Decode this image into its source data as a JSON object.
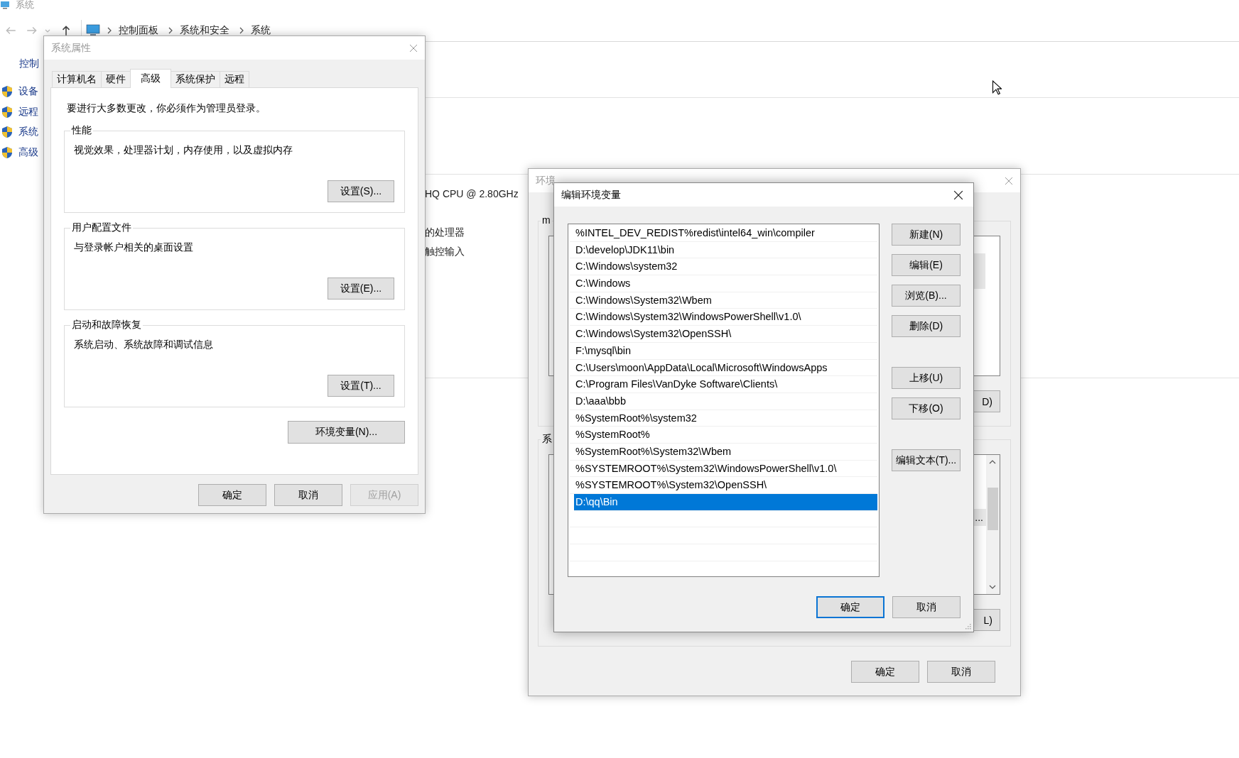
{
  "explorer": {
    "title": "系统",
    "breadcrumb": [
      "控制面板",
      "系统和安全",
      "系统"
    ],
    "sidebar_heading": "控制",
    "sidebar_items": [
      "设备",
      "远程",
      "系统",
      "高级"
    ],
    "info_lines": [
      "HQ CPU @ 2.80GHz",
      "的处理器",
      "触控输入"
    ]
  },
  "system_properties": {
    "title": "系统属性",
    "tabs": [
      {
        "label": "计算机名",
        "selected": false
      },
      {
        "label": "硬件",
        "selected": false
      },
      {
        "label": "高级",
        "selected": true
      },
      {
        "label": "系统保护",
        "selected": false
      },
      {
        "label": "远程",
        "selected": false
      }
    ],
    "notice": "要进行大多数更改，你必须作为管理员登录。",
    "groups": [
      {
        "title": "性能",
        "description": "视觉效果，处理器计划，内存使用，以及虚拟内存",
        "button": "设置(S)..."
      },
      {
        "title": "用户配置文件",
        "description": "与登录帐户相关的桌面设置",
        "button": "设置(E)..."
      },
      {
        "title": "启动和故障恢复",
        "description": "系统启动、系统故障和调试信息",
        "button": "设置(T)..."
      }
    ],
    "env_button": "环境变量(N)...",
    "buttons": [
      {
        "label": "确定",
        "disabled": false
      },
      {
        "label": "取消",
        "disabled": false
      },
      {
        "label": "应用(A)",
        "disabled": true
      }
    ]
  },
  "environment_variables": {
    "title": "环境",
    "user_group_label": "m",
    "system_group_label": "系",
    "system_list_text": "...",
    "user_button": "D)",
    "system_button": "L)",
    "buttons": [
      "确定",
      "取消"
    ]
  },
  "edit_environment_variable": {
    "title": "编辑环境变量",
    "entries": [
      {
        "path": "%INTEL_DEV_REDIST%redist\\intel64_win\\compiler",
        "selected": false
      },
      {
        "path": "D:\\develop\\JDK11\\bin",
        "selected": false
      },
      {
        "path": "C:\\Windows\\system32",
        "selected": false
      },
      {
        "path": "C:\\Windows",
        "selected": false
      },
      {
        "path": "C:\\Windows\\System32\\Wbem",
        "selected": false
      },
      {
        "path": "C:\\Windows\\System32\\WindowsPowerShell\\v1.0\\",
        "selected": false
      },
      {
        "path": "C:\\Windows\\System32\\OpenSSH\\",
        "selected": false
      },
      {
        "path": "F:\\mysql\\bin",
        "selected": false
      },
      {
        "path": "C:\\Users\\moon\\AppData\\Local\\Microsoft\\WindowsApps",
        "selected": false
      },
      {
        "path": "C:\\Program Files\\VanDyke Software\\Clients\\",
        "selected": false
      },
      {
        "path": "D:\\aaa\\bbb",
        "selected": false
      },
      {
        "path": "%SystemRoot%\\system32",
        "selected": false
      },
      {
        "path": "%SystemRoot%",
        "selected": false
      },
      {
        "path": "%SystemRoot%\\System32\\Wbem",
        "selected": false
      },
      {
        "path": "%SYSTEMROOT%\\System32\\WindowsPowerShell\\v1.0\\",
        "selected": false
      },
      {
        "path": "%SYSTEMROOT%\\System32\\OpenSSH\\",
        "selected": false
      },
      {
        "path": "D:\\qq\\Bin",
        "selected": true
      }
    ],
    "side_button_groups": [
      [
        "新建(N)",
        "编辑(E)",
        "浏览(B)...",
        "删除(D)"
      ],
      [
        "上移(U)",
        "下移(O)"
      ],
      [
        "编辑文本(T)..."
      ]
    ],
    "buttons": [
      {
        "label": "确定",
        "default": true
      },
      {
        "label": "取消",
        "default": false
      }
    ]
  }
}
